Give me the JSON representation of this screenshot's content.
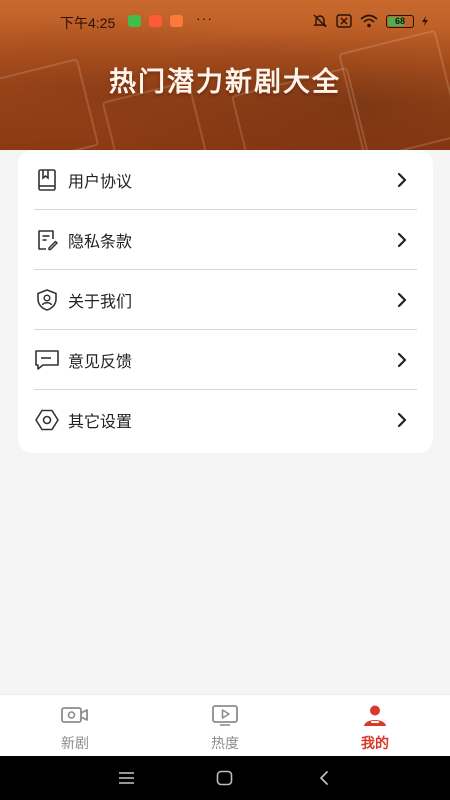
{
  "status_bar": {
    "time": "下午4:25",
    "dots": "···",
    "battery": "68"
  },
  "header": {
    "title": "热门潜力新剧大全"
  },
  "menu": {
    "items": [
      {
        "label": "用户协议",
        "icon": "document-bookmark-icon"
      },
      {
        "label": "隐私条款",
        "icon": "document-edit-icon"
      },
      {
        "label": "关于我们",
        "icon": "shield-user-icon"
      },
      {
        "label": "意见反馈",
        "icon": "message-icon"
      },
      {
        "label": "其它设置",
        "icon": "gear-icon"
      }
    ]
  },
  "tabbar": {
    "tabs": [
      {
        "label": "新剧",
        "icon": "video-camera-icon",
        "active": false
      },
      {
        "label": "热度",
        "icon": "play-icon",
        "active": false
      },
      {
        "label": "我的",
        "icon": "user-icon",
        "active": true
      }
    ]
  },
  "colors": {
    "accent": "#d83a2a",
    "header": "#b4541f",
    "inactive": "#8d8d8d"
  }
}
